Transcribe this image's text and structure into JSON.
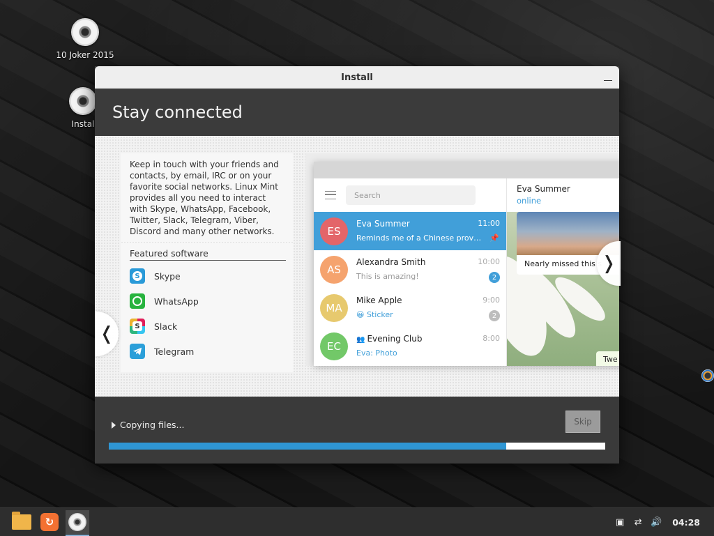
{
  "desktop": {
    "icons": [
      {
        "label": "10 Joker 2015"
      },
      {
        "label": "Instal"
      }
    ]
  },
  "window": {
    "title": "Install",
    "header_title": "Stay connected",
    "description": "Keep in touch with your friends and contacts, by email, IRC or on your favorite social networks. Linux Mint provides all you need to interact with Skype, WhatsApp, Facebook, Twitter, Slack, Telegram, Viber, Discord and many other networks.",
    "featured_title": "Featured software",
    "apps": [
      {
        "name": "Skype",
        "icon": "skype-icon"
      },
      {
        "name": "WhatsApp",
        "icon": "whatsapp-icon"
      },
      {
        "name": "Slack",
        "icon": "slack-icon"
      },
      {
        "name": "Telegram",
        "icon": "telegram-icon"
      }
    ],
    "screenshot": {
      "search_placeholder": "Search",
      "chats": [
        {
          "initials": "ES",
          "name": "Eva Summer",
          "time": "11:00",
          "preview": "Reminds me of a Chinese prover...",
          "color": "#e36569"
        },
        {
          "initials": "AS",
          "name": "Alexandra Smith",
          "time": "10:00",
          "preview": "This is amazing!",
          "badge": "2",
          "color": "#f5a36e"
        },
        {
          "initials": "MA",
          "name": "Mike Apple",
          "time": "9:00",
          "preview": "Sticker",
          "preview_emoji": "😀",
          "badge": "2",
          "color": "#e7c96e"
        },
        {
          "initials": "EC",
          "name": "Evening Club",
          "time": "8:00",
          "preview": "Eva: Photo",
          "color": "#72c868"
        }
      ],
      "conversation": {
        "name": "Eva Summer",
        "status": "online",
        "message": "Nearly missed this s",
        "small_message": "Twe"
      }
    },
    "progress": {
      "label": "Copying files...",
      "fraction": 0.8,
      "skip_label": "Skip"
    },
    "colors": {
      "accent": "#2f96d4",
      "selected_chat": "#419fd9"
    }
  },
  "taskbar": {
    "items": [
      {
        "icon": "folder-icon"
      },
      {
        "icon": "update-manager-icon"
      },
      {
        "icon": "installer-disc-icon"
      }
    ],
    "clock": "04:28"
  }
}
